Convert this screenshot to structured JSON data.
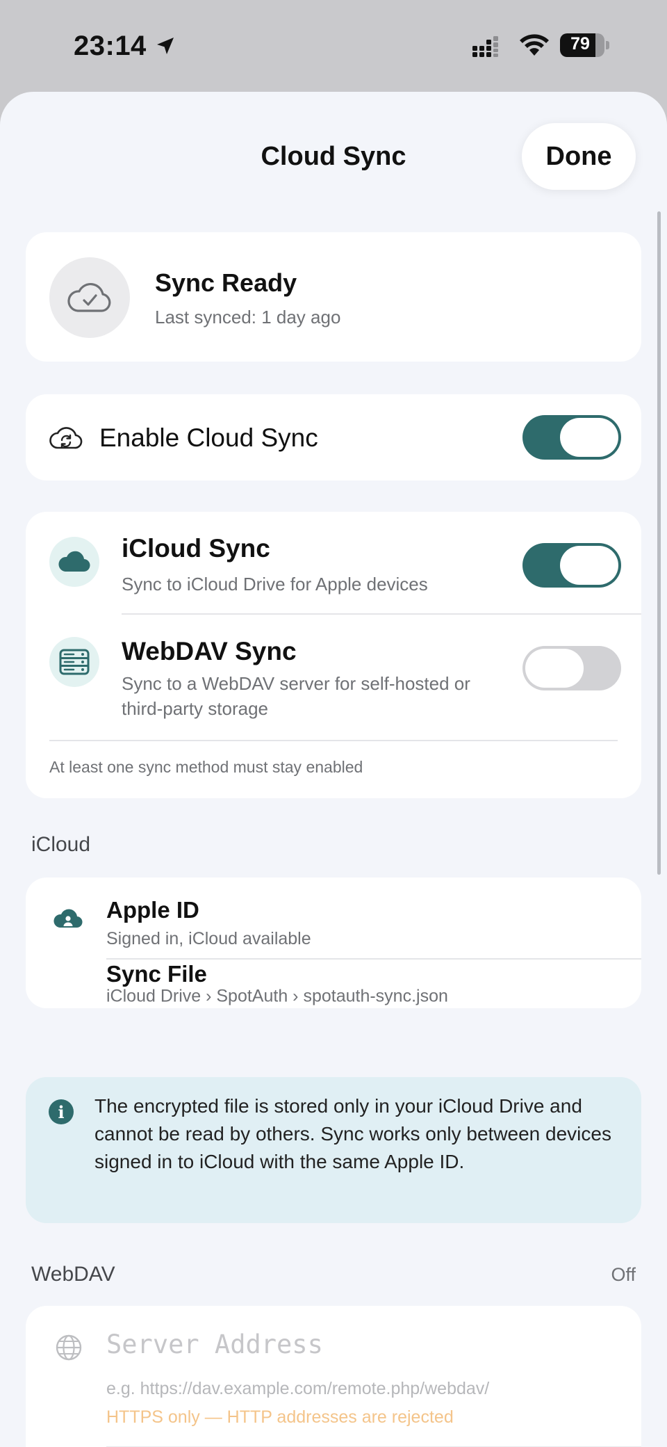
{
  "status_bar": {
    "time": "23:14",
    "battery": "79",
    "battery_level": 0.79
  },
  "header": {
    "title": "Cloud Sync",
    "done_label": "Done"
  },
  "sync_status": {
    "title": "Sync Ready",
    "subtitle": "Last synced: 1 day ago"
  },
  "enable": {
    "label": "Enable Cloud Sync",
    "on": true
  },
  "methods": {
    "icloud": {
      "title": "iCloud Sync",
      "subtitle": "Sync to iCloud Drive for Apple devices",
      "on": true
    },
    "webdav": {
      "title": "WebDAV Sync",
      "subtitle": "Sync to a WebDAV server for self-hosted or third-party storage",
      "on": false
    },
    "note": "At least one sync method must stay enabled"
  },
  "icloud_section": {
    "label": "iCloud",
    "apple_id": {
      "title": "Apple ID",
      "subtitle": "Signed in, iCloud available"
    },
    "sync_file": {
      "title": "Sync File",
      "path": "iCloud Drive › SpotAuth › spotauth-sync.json"
    },
    "info": "The encrypted file is stored only in your iCloud Drive and cannot be read by others. Sync works only between devices signed in to iCloud with the same Apple ID."
  },
  "webdav_section": {
    "label": "WebDAV",
    "status": "Off",
    "server_placeholder": "Server Address",
    "server_value": "",
    "hint": "e.g. https://dav.example.com/remote.php/webdav/",
    "warning": "HTTPS only — HTTP addresses are rejected"
  },
  "colors": {
    "accent": "#2e6b6c",
    "toggle_off": "#d2d2d5",
    "icon_bg": "#e3f2f1",
    "info_bg": "#e0eff4",
    "warning": "#f4c48a"
  }
}
